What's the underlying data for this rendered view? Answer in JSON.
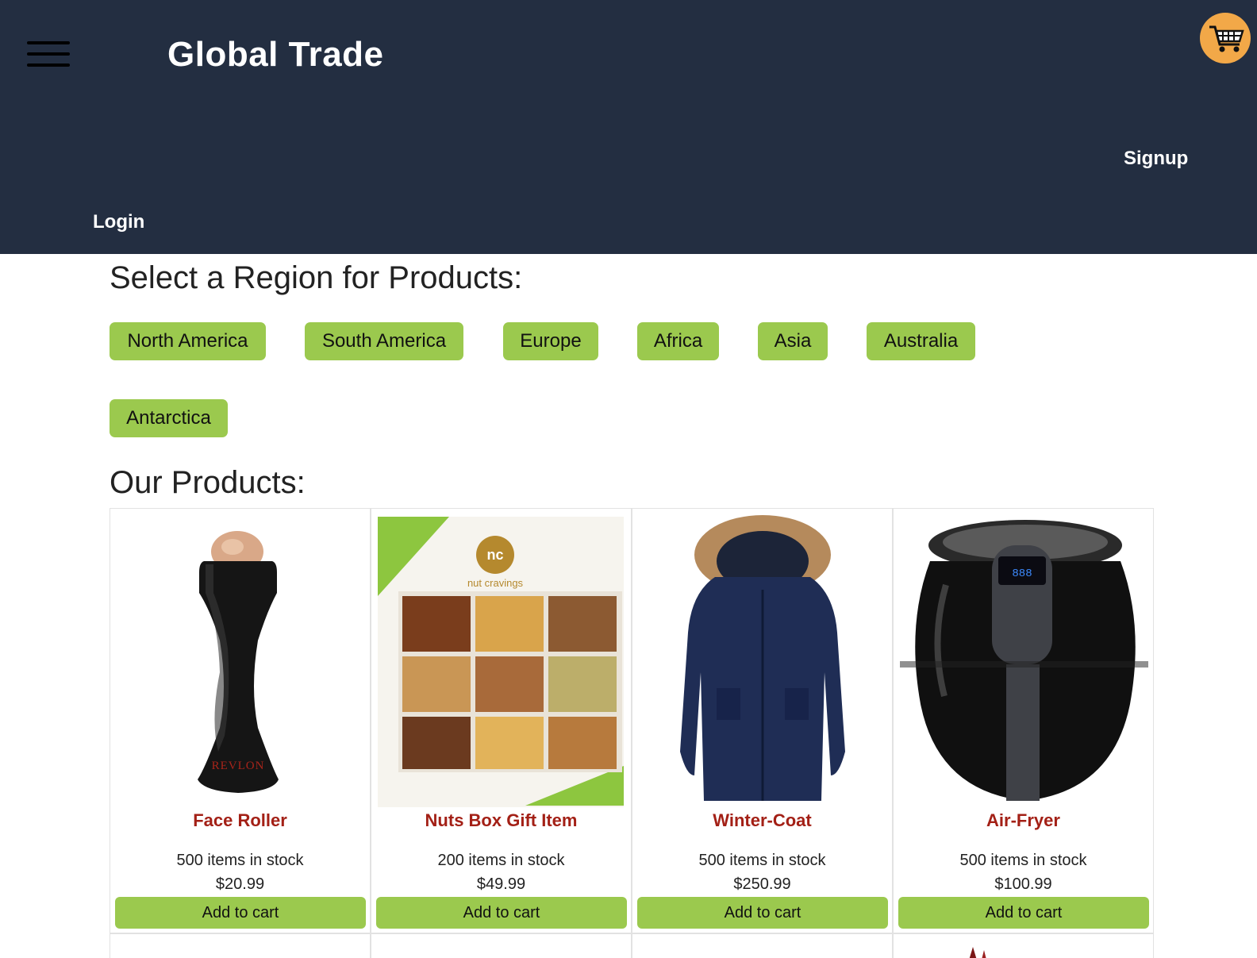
{
  "header": {
    "brand": "Global Trade",
    "signup_label": "Signup",
    "login_label": "Login",
    "menu_icon": "hamburger-menu-icon",
    "cart_icon": "shopping-cart-icon",
    "cart_color": "#f2a848",
    "background": "#232e41"
  },
  "regions": {
    "title": "Select a Region for Products:",
    "items": [
      {
        "label": "North America"
      },
      {
        "label": "South America"
      },
      {
        "label": "Europe"
      },
      {
        "label": "Africa"
      },
      {
        "label": "Asia"
      },
      {
        "label": "Australia"
      },
      {
        "label": "Antarctica"
      }
    ],
    "button_color": "#9bc94e"
  },
  "products": {
    "title": "Our Products:",
    "items": [
      {
        "name": "Face Roller",
        "stock": "500 items in stock",
        "price": "$20.99",
        "button": "Add to cart"
      },
      {
        "name": "Nuts Box Gift Item",
        "stock": "200 items in stock",
        "price": "$49.99",
        "button": "Add to cart"
      },
      {
        "name": "Winter-Coat",
        "stock": "500 items in stock",
        "price": "$250.99",
        "button": "Add to cart"
      },
      {
        "name": "Air-Fryer",
        "stock": "500 items in stock",
        "price": "$100.99",
        "button": "Add to cart"
      }
    ],
    "name_color": "#a32016"
  }
}
